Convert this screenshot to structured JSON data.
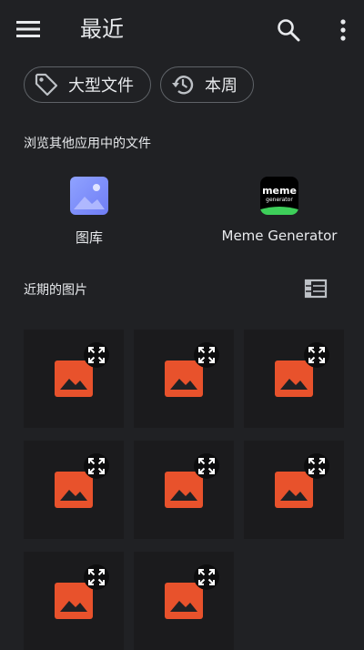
{
  "header": {
    "title": "最近"
  },
  "chips": [
    {
      "label": "大型文件",
      "icon": "tag-icon"
    },
    {
      "label": "本周",
      "icon": "history-icon"
    }
  ],
  "browse": {
    "title": "浏览其他应用中的文件",
    "apps": [
      {
        "label": "图库",
        "icon": "gallery-app-icon"
      },
      {
        "label": "Meme Generator",
        "icon": "meme-generator-app-icon",
        "logo_text": [
          "meme",
          "generator"
        ]
      }
    ]
  },
  "recent": {
    "title": "近期的图片",
    "thumbnails": [
      {
        "icon": "image-placeholder-icon"
      },
      {
        "icon": "image-placeholder-icon"
      },
      {
        "icon": "image-placeholder-icon"
      },
      {
        "icon": "image-placeholder-icon"
      },
      {
        "icon": "image-placeholder-icon"
      },
      {
        "icon": "image-placeholder-icon"
      },
      {
        "icon": "image-placeholder-icon"
      },
      {
        "icon": "image-placeholder-icon"
      }
    ]
  },
  "colors": {
    "background": "#202124",
    "text": "#e8eaed",
    "chip_border": "#5f6368",
    "thumbnail_icon": "#e8522c",
    "gallery_icon": "#7b89f7"
  }
}
